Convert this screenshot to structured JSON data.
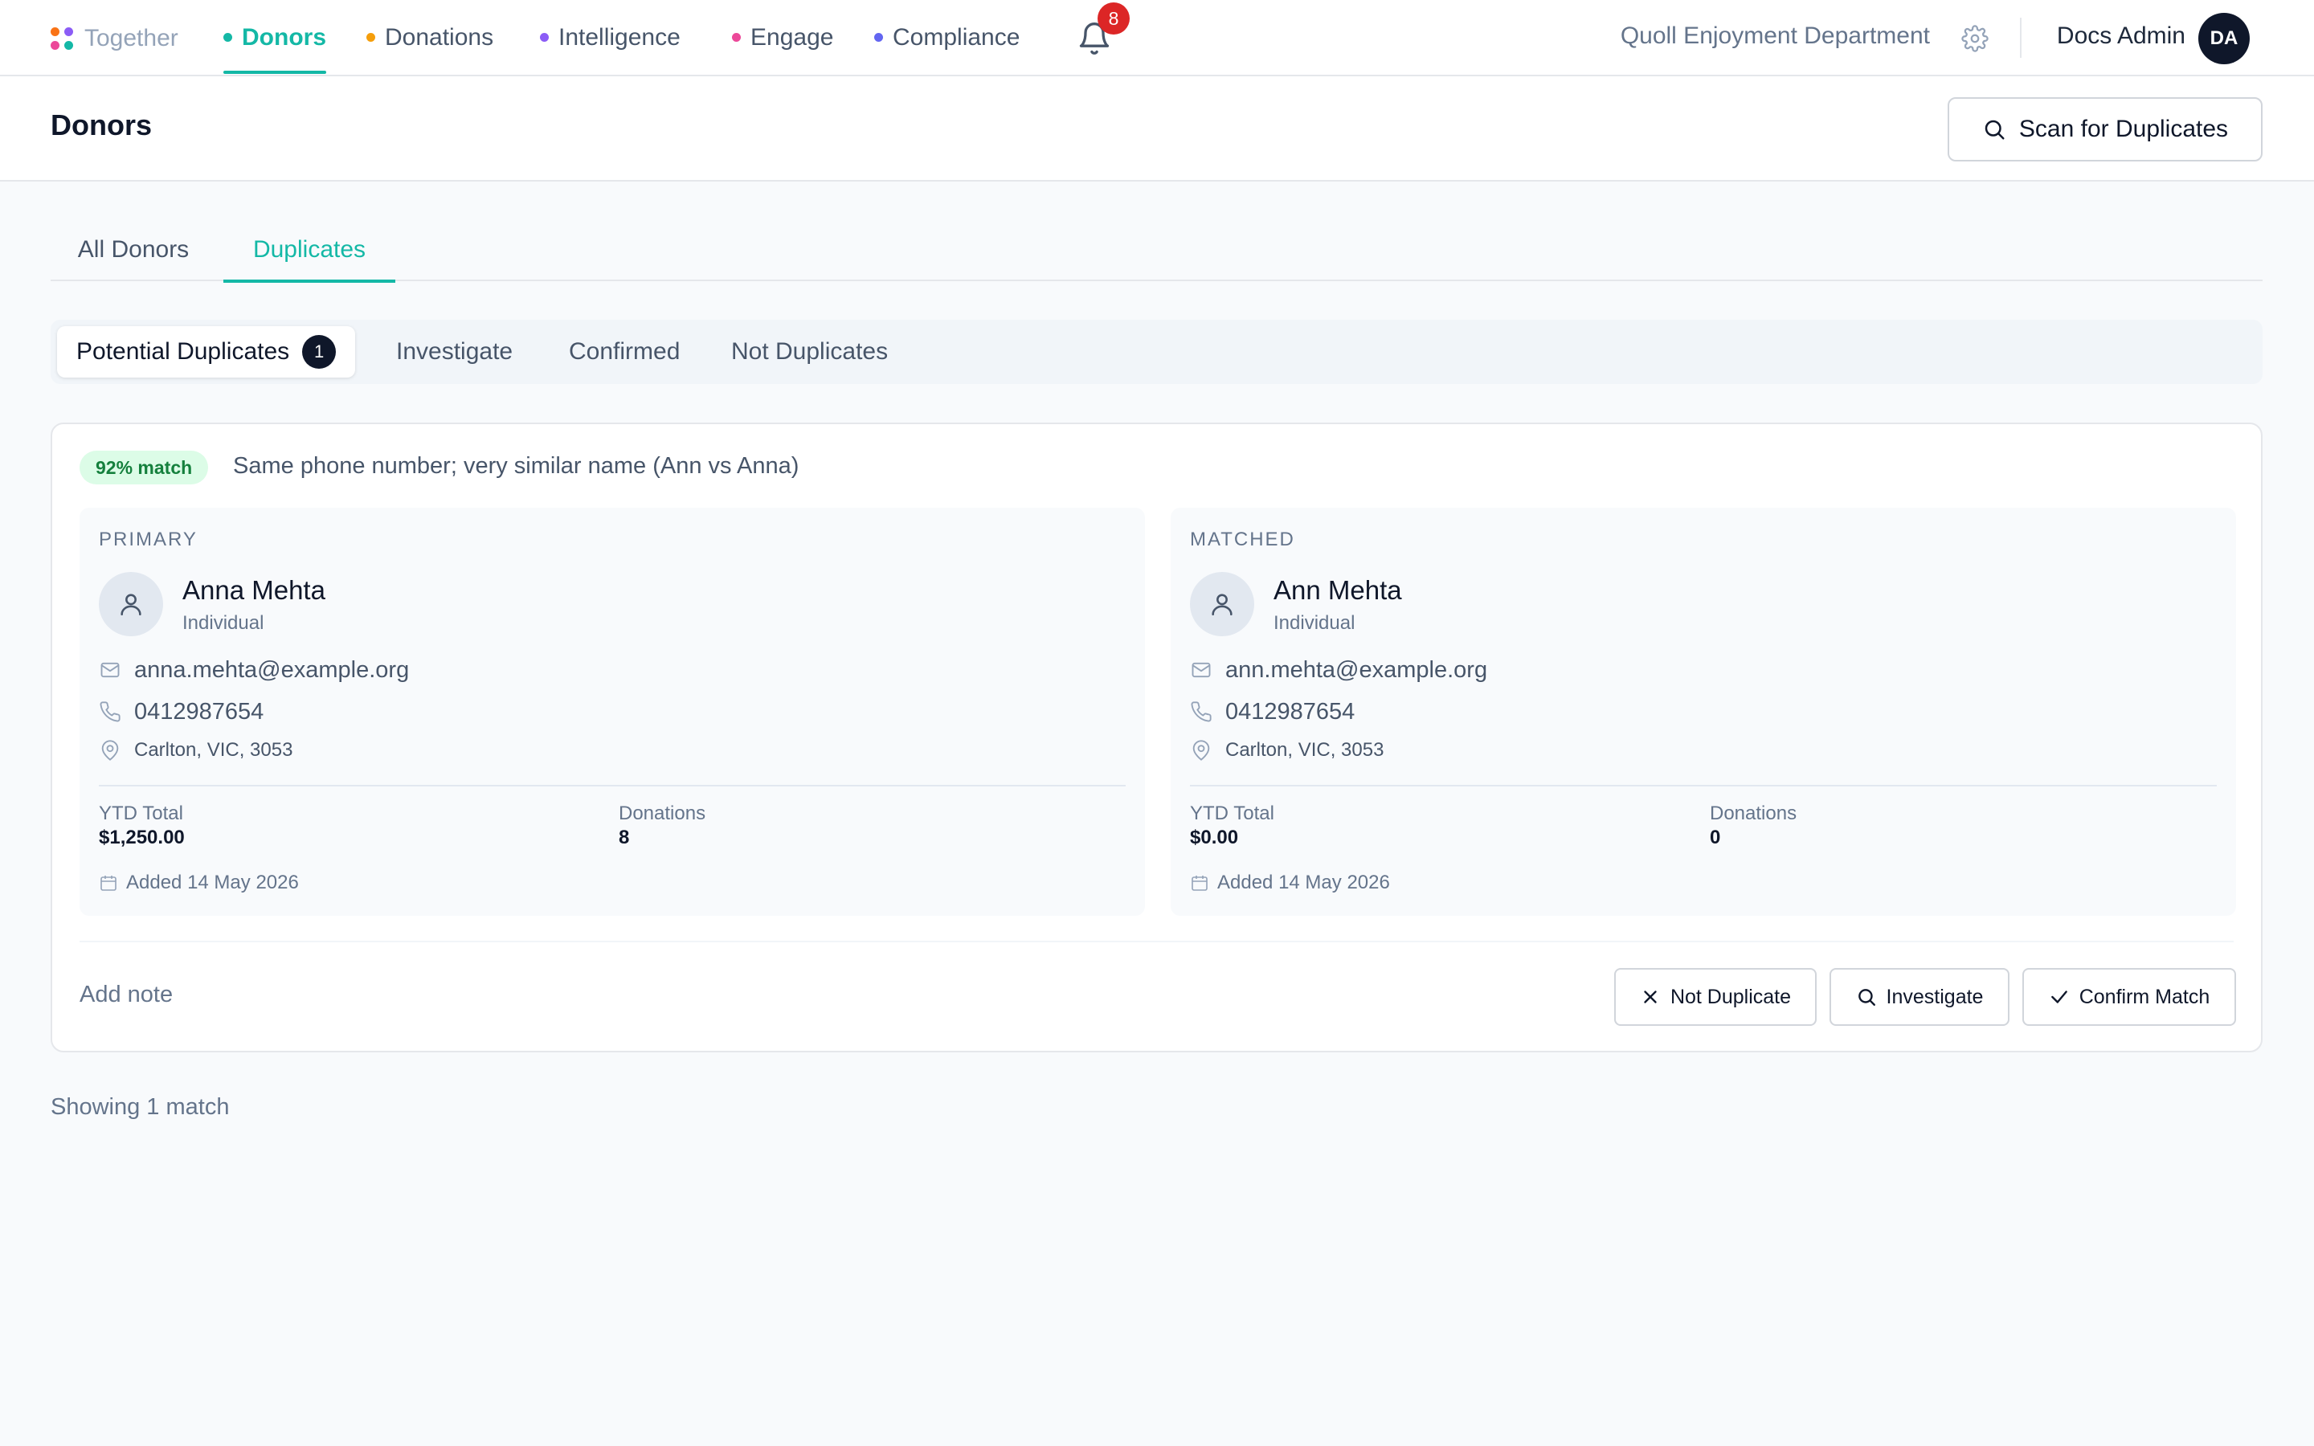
{
  "brand": {
    "name": "Together",
    "dot_colors": [
      "#f97316",
      "#8b5cf6",
      "#ec4899",
      "#14b8a6"
    ]
  },
  "nav": {
    "items": [
      {
        "label": "Donors",
        "dot_color": "#14b8a6",
        "active": true
      },
      {
        "label": "Donations",
        "dot_color": "#f59e0b",
        "active": false
      },
      {
        "label": "Intelligence",
        "dot_color": "#8b5cf6",
        "active": false
      },
      {
        "label": "Engage",
        "dot_color": "#ec4899",
        "active": false
      },
      {
        "label": "Compliance",
        "dot_color": "#6366f1",
        "active": false
      }
    ],
    "notification_count": "8",
    "org_name": "Quoll Enjoyment Department",
    "user_name": "Docs Admin",
    "user_initials": "DA"
  },
  "header": {
    "title": "Donors",
    "scan_button_label": "Scan for Duplicates"
  },
  "tabs": [
    {
      "label": "All Donors",
      "active": false
    },
    {
      "label": "Duplicates",
      "active": true
    }
  ],
  "filters": [
    {
      "label": "Potential Duplicates",
      "count": "1",
      "active": true
    },
    {
      "label": "Investigate",
      "active": false
    },
    {
      "label": "Confirmed",
      "active": false
    },
    {
      "label": "Not Duplicates",
      "active": false
    }
  ],
  "match": {
    "score_label": "92% match",
    "reason": "Same phone number; very similar name (Ann vs Anna)",
    "primary": {
      "heading": "PRIMARY",
      "name": "Anna Mehta",
      "type": "Individual",
      "email": "anna.mehta@example.org",
      "phone": "0412987654",
      "address": "Carlton, VIC, 3053",
      "ytd_label": "YTD Total",
      "ytd_value": "$1,250.00",
      "donations_label": "Donations",
      "donations_value": "8",
      "added": "Added 14 May 2026"
    },
    "matched": {
      "heading": "MATCHED",
      "name": "Ann Mehta",
      "type": "Individual",
      "email": "ann.mehta@example.org",
      "phone": "0412987654",
      "address": "Carlton, VIC, 3053",
      "ytd_label": "YTD Total",
      "ytd_value": "$0.00",
      "donations_label": "Donations",
      "donations_value": "0",
      "added": "Added 14 May 2026"
    },
    "add_note_label": "Add note",
    "actions": {
      "not_duplicate": "Not Duplicate",
      "investigate": "Investigate",
      "confirm": "Confirm Match"
    }
  },
  "footer": {
    "showing": "Showing 1 match"
  },
  "colors": {
    "accent": "#14b8a6",
    "badge_red": "#dc2626",
    "match_badge_bg": "#dcfce7",
    "match_badge_text": "#15803d",
    "dark": "#0f172a"
  }
}
